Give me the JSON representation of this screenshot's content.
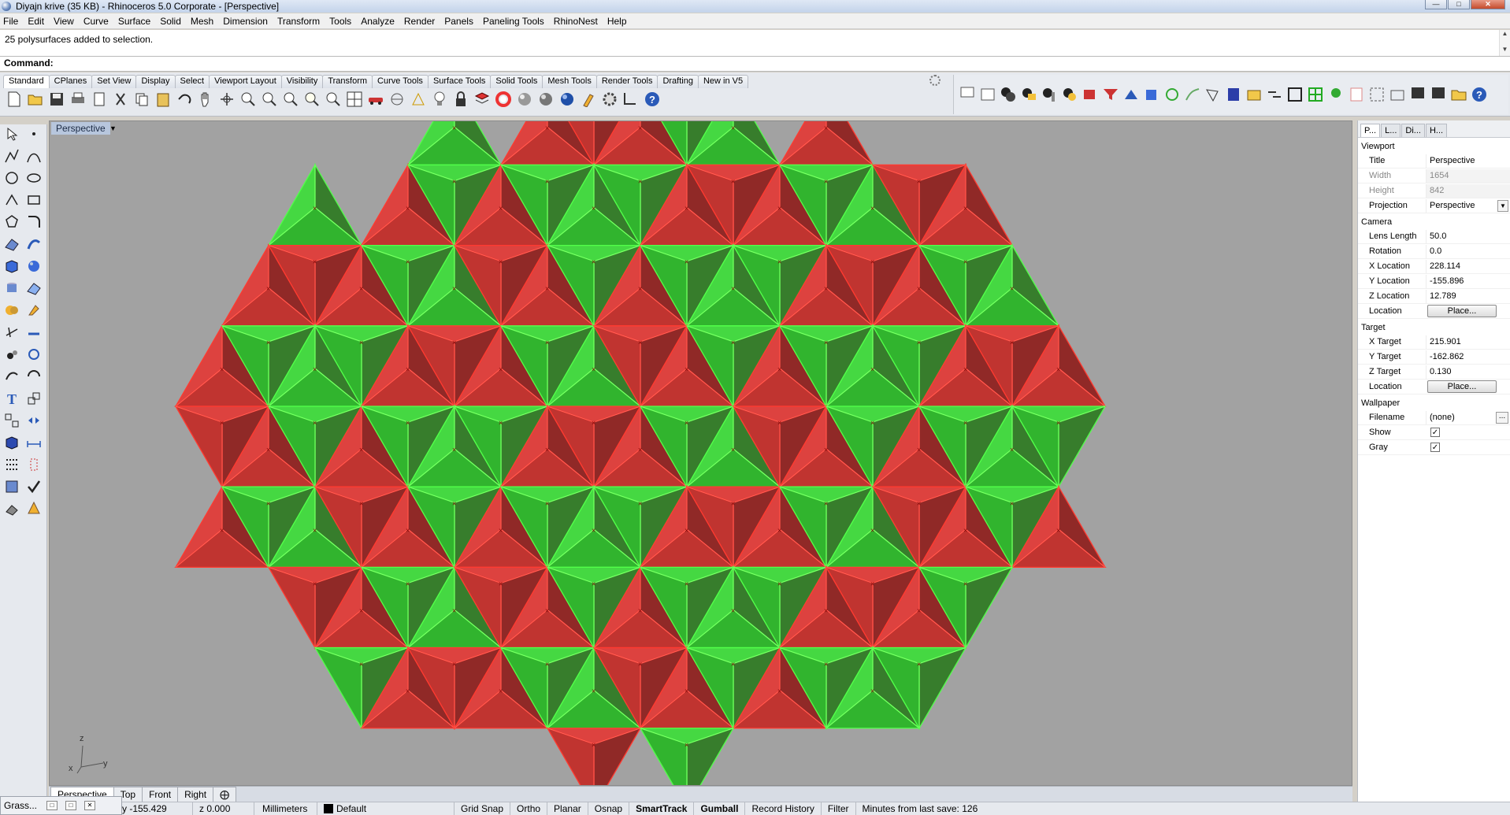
{
  "window": {
    "title": "Diyajn krive (35 KB) - Rhinoceros  5.0 Corporate - [Perspective]"
  },
  "menu": [
    "File",
    "Edit",
    "View",
    "Curve",
    "Surface",
    "Solid",
    "Mesh",
    "Dimension",
    "Transform",
    "Tools",
    "Analyze",
    "Render",
    "Panels",
    "Paneling Tools",
    "RhinoNest",
    "Help"
  ],
  "history": {
    "text": "25 polysurfaces added to selection."
  },
  "command": {
    "label": "Command:"
  },
  "toolbar_tabs": [
    "Standard",
    "CPlanes",
    "Set View",
    "Display",
    "Select",
    "Viewport Layout",
    "Visibility",
    "Transform",
    "Curve Tools",
    "Surface Tools",
    "Solid Tools",
    "Mesh Tools",
    "Render Tools",
    "Drafting",
    "New in V5"
  ],
  "viewport": {
    "label": "Perspective",
    "axis_x": "x",
    "axis_y": "y",
    "axis_z": "z"
  },
  "viewport_tabs": [
    "Perspective",
    "Top",
    "Front",
    "Right"
  ],
  "panel": {
    "tabs": [
      "P...",
      "L...",
      "Di...",
      "H..."
    ],
    "viewport_section": "Viewport",
    "title_label": "Title",
    "title_value": "Perspective",
    "width_label": "Width",
    "width_value": "1654",
    "height_label": "Height",
    "height_value": "842",
    "projection_label": "Projection",
    "projection_value": "Perspective",
    "camera_section": "Camera",
    "lens_label": "Lens Length",
    "lens_value": "50.0",
    "rotation_label": "Rotation",
    "rotation_value": "0.0",
    "xloc_label": "X Location",
    "xloc_value": "228.114",
    "yloc_label": "Y Location",
    "yloc_value": "-155.896",
    "zloc_label": "Z Location",
    "zloc_value": "12.789",
    "location_label": "Location",
    "place_label": "Place...",
    "target_section": "Target",
    "xt_label": "X Target",
    "xt_value": "215.901",
    "yt_label": "Y Target",
    "yt_value": "-162.862",
    "zt_label": "Z Target",
    "zt_value": "0.130",
    "tloc_label": "Location",
    "tplace_label": "Place...",
    "wallpaper_section": "Wallpaper",
    "filename_label": "Filename",
    "filename_value": "(none)",
    "filename_btn": "...",
    "show_label": "Show",
    "gray_label": "Gray"
  },
  "status": {
    "y": "y -155.429",
    "z": "z 0.000",
    "units": "Millimeters",
    "layer": "Default",
    "grid_snap": "Grid Snap",
    "ortho": "Ortho",
    "planar": "Planar",
    "osnap": "Osnap",
    "smarttrack": "SmartTrack",
    "gumball": "Gumball",
    "record_history": "Record History",
    "filter": "Filter",
    "minutes": "Minutes from last save: 126"
  },
  "grasshopper": {
    "label": "Grass..."
  },
  "colors": {
    "green": "#3ddc3a",
    "red": "#e23a36",
    "dark_green": "#2e7a22",
    "dark_red": "#8e1e1c",
    "viewport_bg": "#a2a2a2"
  }
}
